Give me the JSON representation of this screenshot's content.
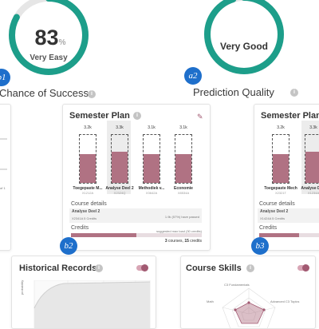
{
  "success": {
    "value": "83",
    "unit": "%",
    "rating": "Very Easy",
    "label": "Chance of Success",
    "badge": "b1",
    "progress": 0.83
  },
  "prediction": {
    "rating": "Very Good",
    "label": "Prediction Quality",
    "badge": "a2",
    "progress": 0.95
  },
  "left_panel": {
    "fragment": "of 1"
  },
  "plan_b2": {
    "title": "Semester Plan",
    "badge": "b2",
    "courses": [
      {
        "top": "3.2k",
        "name": "Toegepaste M...",
        "code": "X1212A",
        "fill": 0.6,
        "highlight": false
      },
      {
        "top": "3.3k",
        "name": "Analyse Deel 2",
        "code": "X2324Q",
        "fill": 0.65,
        "highlight": true
      },
      {
        "top": "3.1k",
        "name": "Methodiek v...",
        "code": "X3642A",
        "fill": 0.6,
        "highlight": false
      },
      {
        "top": "3.1k",
        "name": "Economie",
        "code": "X8534A",
        "fill": 0.6,
        "highlight": false
      }
    ],
    "details_label": "Course details",
    "detail_name": "Analyse Deel 2",
    "detail_meta": "X2341A 5 Credits",
    "detail_passed": "1.9k (57%) have passed",
    "credits_label": "Credits",
    "credits_note": "suggested max load (30 credits)",
    "credits_fill": 0.5,
    "summary_courses": "3",
    "summary_courses_word": "courses,",
    "summary_credits": "15",
    "summary_credits_word": "credits"
  },
  "plan_b3": {
    "title": "Semester Plan",
    "badge": "b3",
    "courses": [
      {
        "top": "3.2k",
        "name": "Toegepaste Mech",
        "code": "X2321T",
        "fill": 0.6,
        "highlight": false
      },
      {
        "top": "3.3k",
        "name": "Analyse Deel",
        "code": "X1234A",
        "fill": 0.65,
        "highlight": true
      }
    ],
    "details_label": "Course details",
    "detail_name": "Analyse Deel 2",
    "detail_meta": "X1424A 5 Credits",
    "credits_label": "Credits",
    "credits_fill": 0.5
  },
  "historical": {
    "title": "Historical Records",
    "y_axis": "probability"
  },
  "skills": {
    "title": "Course Skills",
    "axes": [
      "C3 Fundamentals",
      "Advanced C3 Topics",
      "Math"
    ]
  },
  "colors": {
    "ring": "#1d9e8a",
    "bar": "#b07283",
    "badge": "#1e6fcb"
  }
}
